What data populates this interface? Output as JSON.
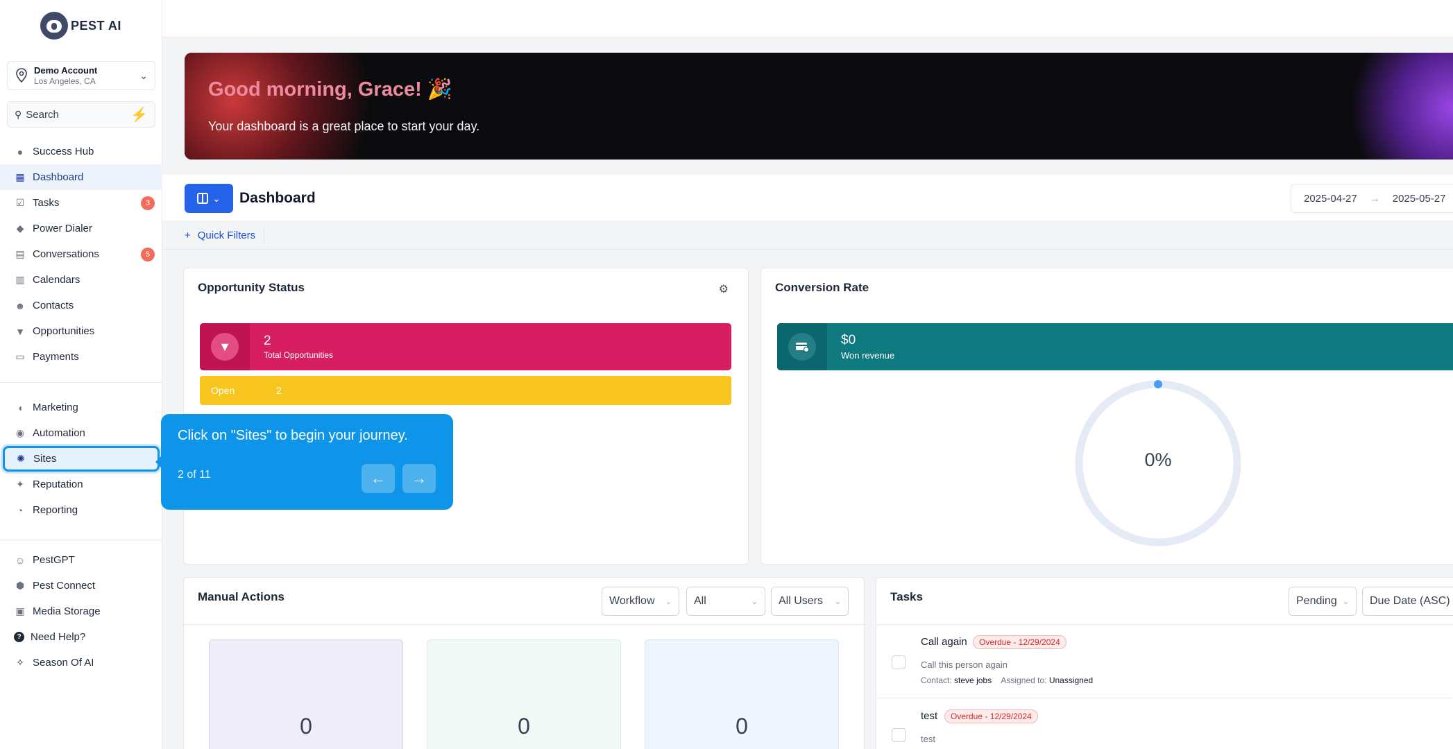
{
  "brand": {
    "name": "PEST AI"
  },
  "account": {
    "name": "Demo Account",
    "location": "Los Angeles, CA"
  },
  "search": {
    "label": "Search"
  },
  "nav": {
    "group1": [
      {
        "label": "Success Hub",
        "icon": "medal-icon"
      },
      {
        "label": "Dashboard",
        "icon": "dashboard-icon",
        "active": true
      },
      {
        "label": "Tasks",
        "icon": "check-icon",
        "badge": "3"
      },
      {
        "label": "Power Dialer",
        "icon": "diamond-icon"
      },
      {
        "label": "Conversations",
        "icon": "chat-icon",
        "badge": "5"
      },
      {
        "label": "Calendars",
        "icon": "calendar-icon"
      },
      {
        "label": "Contacts",
        "icon": "person-icon"
      },
      {
        "label": "Opportunities",
        "icon": "funnel-icon"
      },
      {
        "label": "Payments",
        "icon": "card-icon"
      }
    ],
    "group2": [
      {
        "label": "Marketing",
        "icon": "megaphone-icon"
      },
      {
        "label": "Automation",
        "icon": "automation-icon"
      },
      {
        "label": "Sites",
        "icon": "globe-icon",
        "highlighted": true
      },
      {
        "label": "Reputation",
        "icon": "star-icon"
      },
      {
        "label": "Reporting",
        "icon": "pie-icon"
      }
    ],
    "group3": [
      {
        "label": "PestGPT",
        "icon": "robot-icon"
      },
      {
        "label": "Pest Connect",
        "icon": "hexagon-icon"
      },
      {
        "label": "Media Storage",
        "icon": "image-icon"
      },
      {
        "label": "Need Help?",
        "icon": "help-icon"
      },
      {
        "label": "Season Of AI",
        "icon": "sparkle-icon"
      }
    ]
  },
  "hero": {
    "greeting": "Good morning, Grace! 🎉",
    "subtitle": "Your dashboard is a great place to start your day."
  },
  "dashboard": {
    "title": "Dashboard",
    "date_from": "2025-04-27",
    "date_to": "2025-05-27",
    "quick_filters": "Quick Filters"
  },
  "opportunity_status": {
    "title": "Opportunity Status",
    "total_value": "2",
    "total_label": "Total Opportunities",
    "open_label": "Open",
    "open_value": "2"
  },
  "conversion_rate": {
    "title": "Conversion Rate",
    "won_value": "$0",
    "won_label": "Won revenue",
    "rate": "0%",
    "rate_fraction": 0
  },
  "manual_actions": {
    "title": "Manual Actions",
    "filters": [
      "Workflow",
      "All",
      "All Users"
    ],
    "stats": [
      {
        "value": "0",
        "bg": "#efedfa",
        "border": "#d9d4f2"
      },
      {
        "value": "0",
        "bg": "#f1f8f6",
        "border": "#dcede7"
      },
      {
        "value": "0",
        "bg": "#eef5fc",
        "border": "#d5e6f7"
      }
    ]
  },
  "tasks": {
    "title": "Tasks",
    "filter_status": "Pending",
    "filter_sort": "Due Date (ASC)",
    "items": [
      {
        "title": "Call again",
        "overdue": "Overdue - 12/29/2024",
        "description": "Call this person again",
        "contact_label": "Contact:",
        "contact": "steve jobs",
        "assigned_label": "Assigned to:",
        "assigned": "Unassigned"
      },
      {
        "title": "test",
        "overdue": "Overdue - 12/29/2024",
        "description": "test"
      }
    ]
  },
  "tour": {
    "message": "Click on \"Sites\" to begin your journey.",
    "step": "2 of 11"
  },
  "colors": {
    "primary": "#2563eb",
    "opportunity_total": "#d81e62",
    "opportunity_open": "#f7c51d",
    "conversion": "#0f7980",
    "tour": "#0e94e8",
    "badge": "#f26b5b"
  }
}
